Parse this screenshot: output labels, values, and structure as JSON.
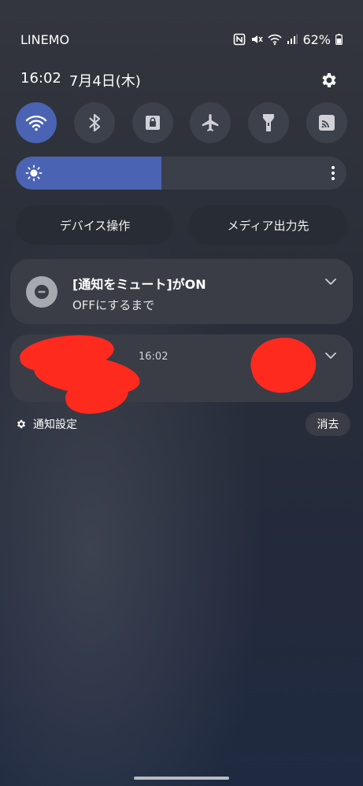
{
  "status_bar": {
    "carrier": "LINEMO",
    "icons": [
      "nfc-icon",
      "mute-icon",
      "wifi-icon",
      "signal-icon",
      "battery-icon"
    ],
    "battery": "62%"
  },
  "header": {
    "time": "16:02",
    "date": "7月4日(木)",
    "settings_icon": "gear-icon"
  },
  "quick_settings": {
    "tiles": [
      {
        "name": "wifi",
        "icon": "wifi-icon",
        "active": true
      },
      {
        "name": "bluetooth",
        "icon": "bluetooth-icon",
        "active": false
      },
      {
        "name": "rotation-lock",
        "icon": "lock-icon",
        "active": false
      },
      {
        "name": "airplane-mode",
        "icon": "airplane-icon",
        "active": false
      },
      {
        "name": "flashlight",
        "icon": "flashlight-icon",
        "active": false
      },
      {
        "name": "cast",
        "icon": "cast-icon",
        "active": false
      }
    ],
    "accent": "#4a63b2"
  },
  "brightness": {
    "level": 0.44
  },
  "pills": {
    "device_control": "デバイス操作",
    "media_output": "メディア出力先"
  },
  "notifications": {
    "mute": {
      "title": "[通知をミュート]がON",
      "subtitle": "OFFにするまで"
    },
    "app": {
      "time": "16:02"
    }
  },
  "footer": {
    "settings_label": "通知設定",
    "clear_label": "消去"
  }
}
